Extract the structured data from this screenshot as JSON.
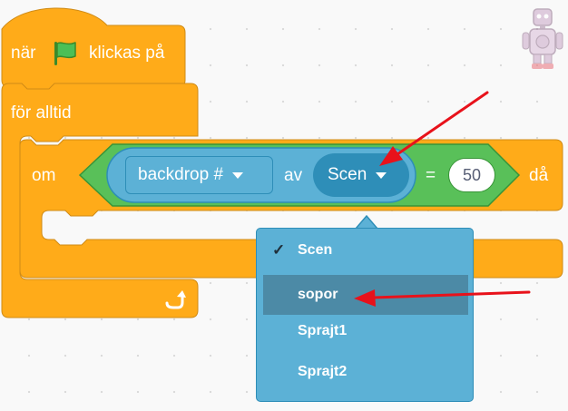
{
  "hat_block": {
    "prefix": "när",
    "suffix": "klickas på",
    "flag_icon": "green-flag-icon"
  },
  "forever_block": {
    "label": "för alltid",
    "loop_icon": "loop-arrow-icon"
  },
  "if_block": {
    "label_if": "om",
    "label_then": "då"
  },
  "backdrop_reporter": {
    "attribute": "backdrop #",
    "of_label": "av",
    "target": "Scen"
  },
  "equals_operator": {
    "symbol": "=",
    "value": "50"
  },
  "dropdown": {
    "items": [
      {
        "label": "Scen",
        "checked": true
      },
      {
        "label": "sopor",
        "highlighted": true
      },
      {
        "label": "Sprajt1"
      },
      {
        "label": "Sprajt2"
      }
    ],
    "check_mark": "✓"
  },
  "sprite_thumbnail": {
    "icon": "robot-sprite-icon"
  },
  "colors": {
    "control": "#ffab19",
    "control_dark": "#cf8b17",
    "operator": "#59c059",
    "sensing": "#5cb1d6",
    "sensing_dark": "#2e8eb8",
    "annotation_arrow": "#e8121b"
  }
}
